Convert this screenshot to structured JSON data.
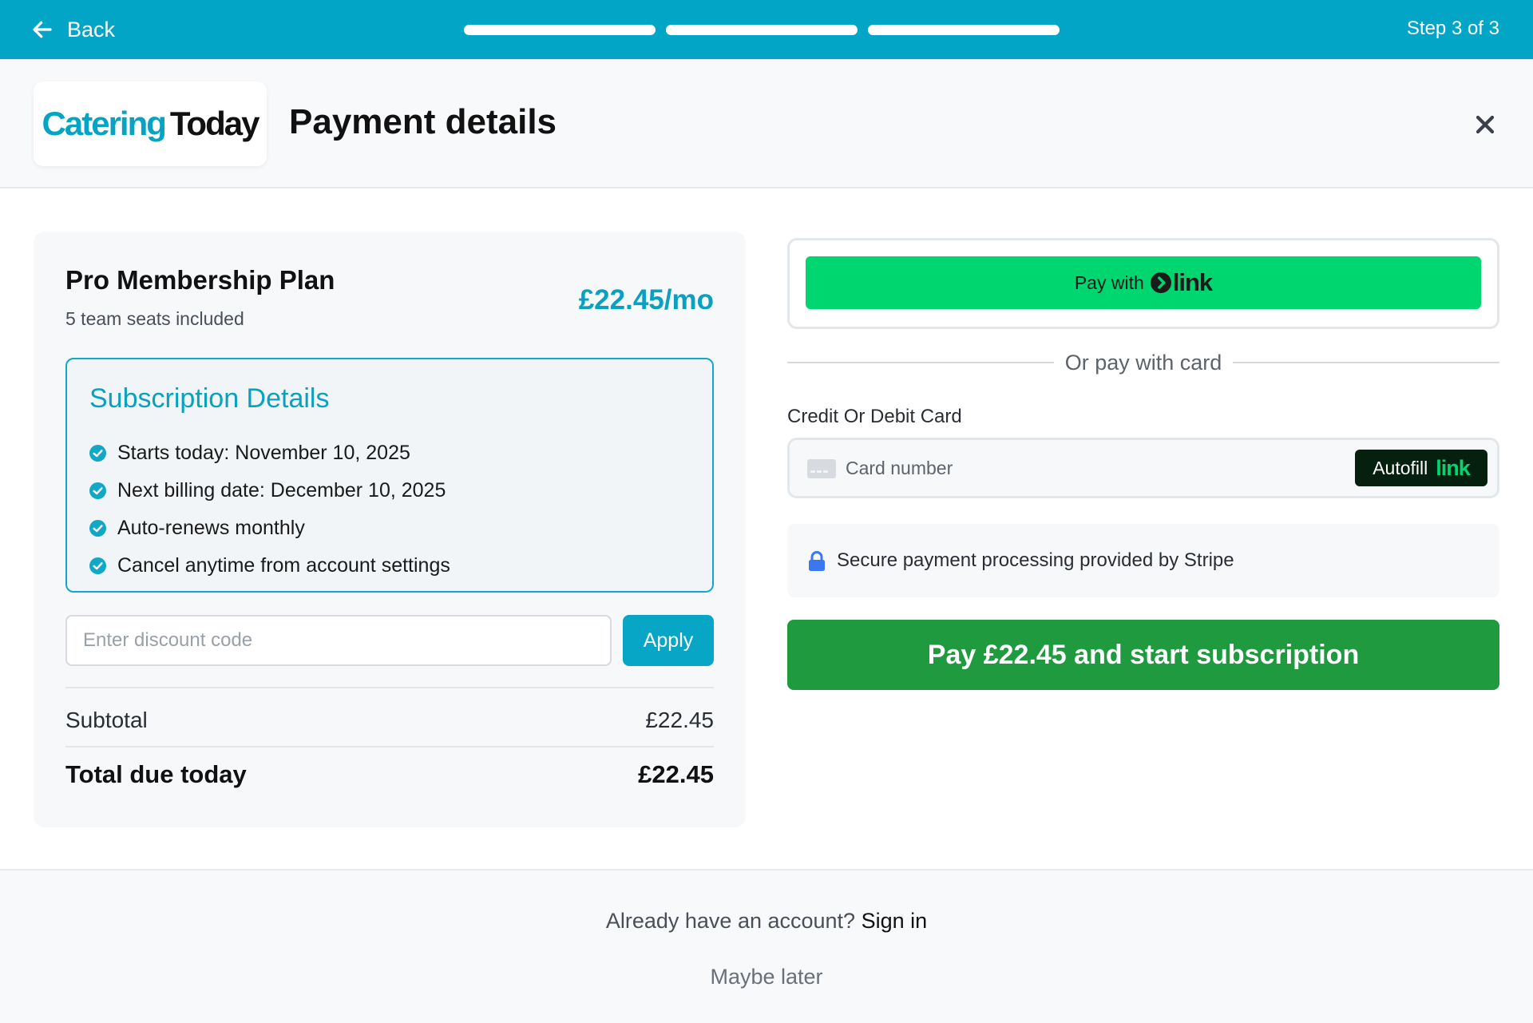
{
  "topbar": {
    "back_label": "Back",
    "step_text": "Step 3 of 3",
    "progress_total": 3,
    "progress_completed": 3,
    "color": "#02a5c6"
  },
  "header": {
    "logo_word1": "Catering",
    "logo_word2": "Today",
    "title": "Payment details"
  },
  "plan": {
    "name": "Pro Membership Plan",
    "seats": "5 team seats included",
    "price": "£22.45/mo"
  },
  "subscription": {
    "title": "Subscription Details",
    "items": [
      "Starts today: November 10, 2025",
      "Next billing date: December 10, 2025",
      "Auto-renews monthly",
      "Cancel anytime from account settings"
    ]
  },
  "discount": {
    "placeholder": "Enter discount code",
    "value": "",
    "apply_label": "Apply"
  },
  "summary": {
    "subtotal_label": "Subtotal",
    "subtotal_value": "£22.45",
    "total_label": "Total due today",
    "total_value": "£22.45"
  },
  "link_pay": {
    "prefix": "Pay with",
    "brand": "link",
    "color": "#00d66f"
  },
  "divider_text": "Or pay with card",
  "card": {
    "label": "Credit Or Debit Card",
    "placeholder": "Card number",
    "autofill_label": "Autofill",
    "autofill_brand": "link"
  },
  "secure_text": "Secure payment processing provided by Stripe",
  "pay_button": {
    "label": "Pay £22.45 and start subscription",
    "color": "#1f9a3f"
  },
  "footer": {
    "already_text": "Already have an account?",
    "sign_in": "Sign in",
    "maybe_later": "Maybe later"
  },
  "icons": {
    "back": "arrow-left-icon",
    "close": "close-icon",
    "check": "check-circle-icon",
    "card": "credit-card-icon",
    "lock": "lock-icon",
    "link": "link-chevron-icon"
  }
}
